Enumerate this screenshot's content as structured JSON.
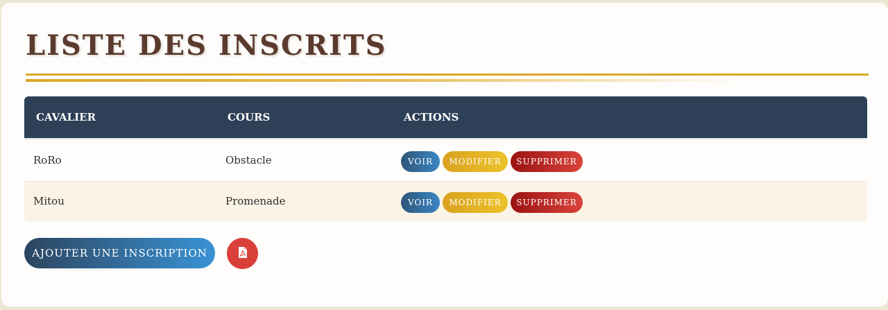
{
  "page": {
    "title": "LISTE DES INSCRITS"
  },
  "table": {
    "headers": {
      "cavalier": "CAVALIER",
      "cours": "COURS",
      "actions": "ACTIONS"
    },
    "rows": [
      {
        "cavalier": "RoRo",
        "cours": "Obstacle"
      },
      {
        "cavalier": "Mitou",
        "cours": "Promenade"
      }
    ],
    "action_labels": {
      "voir": "VOIR",
      "modifier": "MODIFIER",
      "supprimer": "SUPPRIMER"
    }
  },
  "footer": {
    "add_label": "AJOUTER UNE INSCRIPTION",
    "pdf_icon": "file-pdf-icon"
  },
  "colors": {
    "header_bg": "#2e4057",
    "gold_rule": "#d9a726",
    "title": "#5b3a2e",
    "voir": "#3a86c4",
    "modifier": "#ecc22a",
    "supprimer": "#c62828",
    "pdf": "#d9403a"
  }
}
